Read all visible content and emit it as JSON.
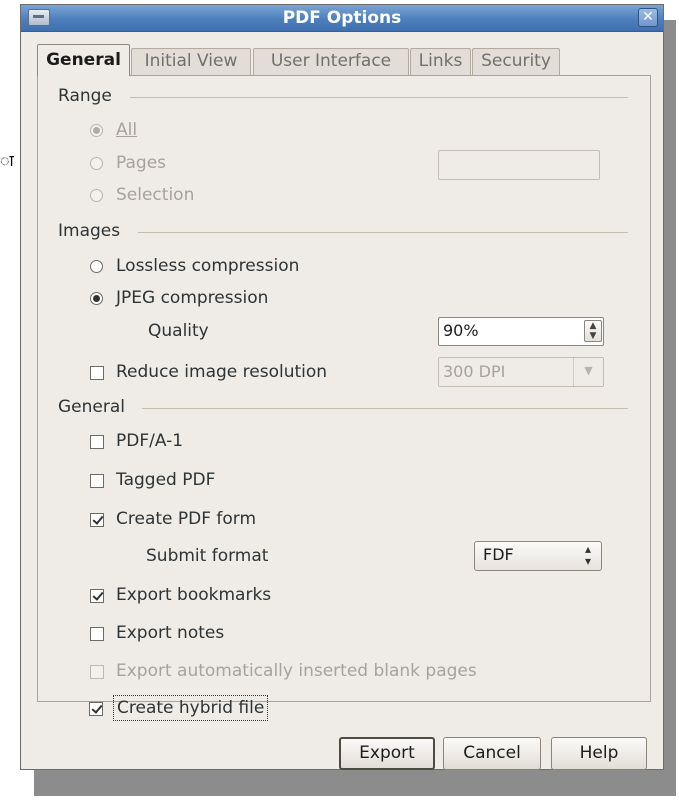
{
  "stray_text": "ा",
  "window": {
    "title": "PDF Options",
    "close_glyph": "✕"
  },
  "tabs": [
    "General",
    "Initial View",
    "User Interface",
    "Links",
    "Security"
  ],
  "range": {
    "heading": "Range",
    "all_label": "All",
    "pages_label": "Pages",
    "selection_label": "Selection",
    "pages_value": ""
  },
  "images": {
    "heading": "Images",
    "lossless_label": "Lossless compression",
    "jpeg_label": "JPEG compression",
    "quality_label": "Quality",
    "quality_value": "90%",
    "reduce_label": "Reduce image resolution",
    "resolution_value": "300 DPI"
  },
  "general": {
    "heading": "General",
    "pdfa_label": "PDF/A-1",
    "tagged_label": "Tagged PDF",
    "form_label": "Create PDF form",
    "submit_format_label": "Submit format",
    "submit_format_value": "FDF",
    "bookmarks_label": "Export bookmarks",
    "notes_label": "Export notes",
    "blank_pages_label": "Export automatically inserted blank pages",
    "hybrid_label": "Create hybrid file"
  },
  "buttons": {
    "export": "Export",
    "cancel": "Cancel",
    "help": "Help"
  },
  "state": {
    "range_selected": "All",
    "images_selected": "JPEG compression",
    "reduce_resolution": false,
    "pdfa": false,
    "tagged": false,
    "create_form": true,
    "bookmarks": true,
    "notes": false,
    "blank_pages": false,
    "hybrid": true
  }
}
